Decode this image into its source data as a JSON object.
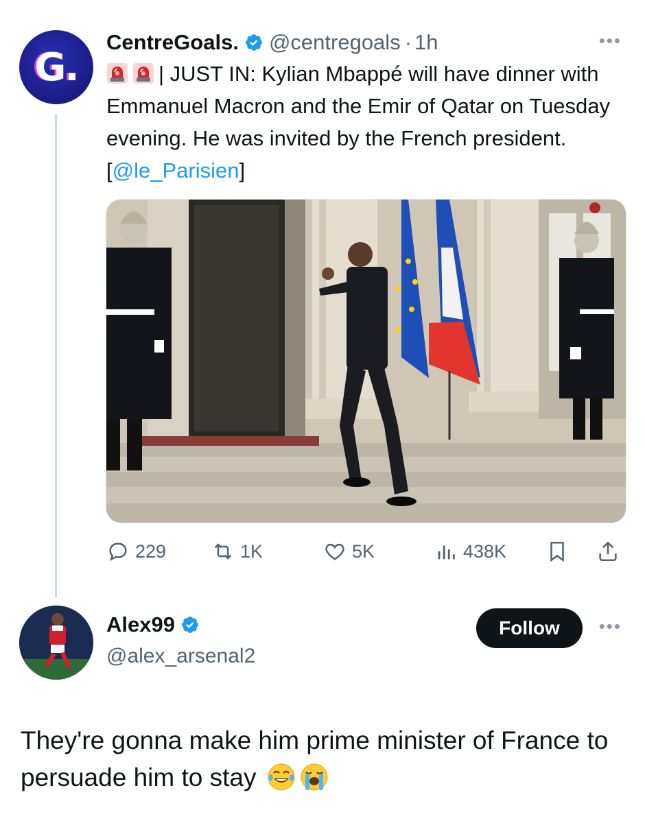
{
  "tweet": {
    "author_name": "CentreGoals.",
    "author_handle": "@centregoals",
    "separator": "·",
    "time": "1h",
    "avatar_letter": "G.",
    "text_prefix": "| JUST IN: Kylian Mbappé will have dinner with Emmanuel Macron and the Emir of Qatar on Tuesday evening. He was invited by the French president. [",
    "mention": "@le_Parisien",
    "text_suffix": "]",
    "emojis": [
      "siren-emoji",
      "siren-emoji"
    ],
    "image_alt": "Kylian Mbappé waving on the steps of the Élysée Palace between two Republican Guards, EU and French flags",
    "stats": {
      "replies": "229",
      "reposts": "1K",
      "likes": "5K",
      "views": "438K"
    }
  },
  "reply": {
    "author_name": "Alex99",
    "author_handle": "@alex_arsenal2",
    "follow_label": "Follow",
    "text": "They're gonna make him prime minister of France to persuade him to stay",
    "emojis": [
      "face-with-tears-of-joy-emoji",
      "loudly-crying-face-emoji"
    ]
  },
  "colors": {
    "accent": "#1d9bf0",
    "text": "#0f1419",
    "muted": "#536471",
    "avatar_bg": "#1d1f8e"
  }
}
